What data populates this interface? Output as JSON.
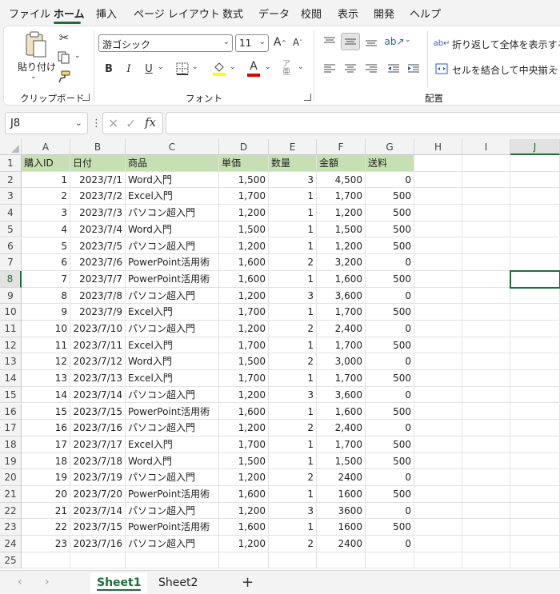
{
  "menu": {
    "tabs": [
      "ファイル",
      "ホーム",
      "挿入",
      "ページ レイアウト",
      "数式",
      "データ",
      "校閲",
      "表示",
      "開発",
      "ヘルプ"
    ],
    "active_index": 1
  },
  "ribbon": {
    "clipboard": {
      "paste_label": "貼り付け",
      "group_label": "クリップボード"
    },
    "font": {
      "font_name": "游ゴシック",
      "font_size": "11",
      "group_label": "フォント",
      "bold": "B",
      "italic": "I",
      "underline": "U",
      "grow": "A",
      "shrink": "A",
      "font_color_letter": "A",
      "highlight_color": "#ffff00",
      "font_color": "#e00000"
    },
    "alignment": {
      "wrap_label": "折り返して全体を表示する",
      "merge_label": "セルを結合して中央揃え",
      "group_label": "配置"
    }
  },
  "formula_bar": {
    "name_box": "J8",
    "fx_label": "fx",
    "formula": ""
  },
  "grid": {
    "columns": [
      "A",
      "B",
      "C",
      "D",
      "E",
      "F",
      "G",
      "H",
      "I",
      "J"
    ],
    "selected_column": "J",
    "selected_row": 8,
    "row_numbers": [
      1,
      2,
      3,
      4,
      5,
      6,
      7,
      8,
      9,
      10,
      11,
      12,
      13,
      14,
      15,
      16,
      17,
      18,
      19,
      20,
      21,
      22,
      23,
      24,
      25
    ],
    "header_row": [
      "購入ID",
      "日付",
      "商品",
      "単価",
      "数量",
      "金額",
      "送料"
    ],
    "rows": [
      [
        "1",
        "2023/7/1",
        "Word入門",
        "1,500",
        "3",
        "4,500",
        "0"
      ],
      [
        "2",
        "2023/7/2",
        "Excel入門",
        "1,700",
        "1",
        "1,700",
        "500"
      ],
      [
        "3",
        "2023/7/3",
        "パソコン超入門",
        "1,200",
        "1",
        "1,200",
        "500"
      ],
      [
        "4",
        "2023/7/4",
        "Word入門",
        "1,500",
        "1",
        "1,500",
        "500"
      ],
      [
        "5",
        "2023/7/5",
        "パソコン超入門",
        "1,200",
        "1",
        "1,200",
        "500"
      ],
      [
        "6",
        "2023/7/6",
        "PowerPoint活用術",
        "1,600",
        "2",
        "3,200",
        "0"
      ],
      [
        "7",
        "2023/7/7",
        "PowerPoint活用術",
        "1,600",
        "1",
        "1,600",
        "500"
      ],
      [
        "8",
        "2023/7/8",
        "パソコン超入門",
        "1,200",
        "3",
        "3,600",
        "0"
      ],
      [
        "9",
        "2023/7/9",
        "Excel入門",
        "1,700",
        "1",
        "1,700",
        "500"
      ],
      [
        "10",
        "2023/7/10",
        "パソコン超入門",
        "1,200",
        "2",
        "2,400",
        "0"
      ],
      [
        "11",
        "2023/7/11",
        "Excel入門",
        "1,700",
        "1",
        "1,700",
        "500"
      ],
      [
        "12",
        "2023/7/12",
        "Word入門",
        "1,500",
        "2",
        "3,000",
        "0"
      ],
      [
        "13",
        "2023/7/13",
        "Excel入門",
        "1,700",
        "1",
        "1,700",
        "500"
      ],
      [
        "14",
        "2023/7/14",
        "パソコン超入門",
        "1,200",
        "3",
        "3,600",
        "0"
      ],
      [
        "15",
        "2023/7/15",
        "PowerPoint活用術",
        "1,600",
        "1",
        "1,600",
        "500"
      ],
      [
        "16",
        "2023/7/16",
        "パソコン超入門",
        "1,200",
        "2",
        "2,400",
        "0"
      ],
      [
        "17",
        "2023/7/17",
        "Excel入門",
        "1,700",
        "1",
        "1,700",
        "500"
      ],
      [
        "18",
        "2023/7/18",
        "Word入門",
        "1,500",
        "1",
        "1,500",
        "500"
      ],
      [
        "19",
        "2023/7/19",
        "パソコン超入門",
        "1,200",
        "2",
        "2400",
        "0"
      ],
      [
        "20",
        "2023/7/20",
        "PowerPoint活用術",
        "1,600",
        "1",
        "1600",
        "500"
      ],
      [
        "21",
        "2023/7/14",
        "パソコン超入門",
        "1,200",
        "3",
        "3600",
        "0"
      ],
      [
        "22",
        "2023/7/15",
        "PowerPoint活用術",
        "1,600",
        "1",
        "1600",
        "500"
      ],
      [
        "23",
        "2023/7/16",
        "パソコン超入門",
        "1,200",
        "2",
        "2400",
        "0"
      ]
    ],
    "header_fill_color": "#c6e0b4"
  },
  "sheets": {
    "tabs": [
      "Sheet1",
      "Sheet2"
    ],
    "active_index": 0,
    "add_label": "+"
  }
}
